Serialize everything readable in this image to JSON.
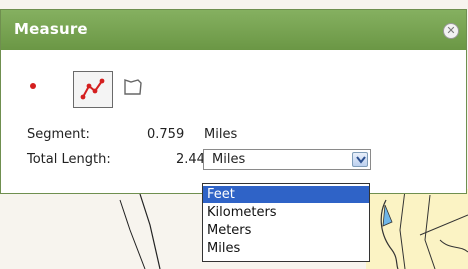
{
  "panel": {
    "title": "Measure",
    "close_icon": "close-circle-icon"
  },
  "tools": [
    {
      "name": "point-tool",
      "icon": "red-dot-icon",
      "color": "#d41f1f"
    },
    {
      "name": "line-tool",
      "icon": "polyline-icon",
      "color": "#d41f1f",
      "active": true
    },
    {
      "name": "area-tool",
      "icon": "polygon-outline-icon"
    }
  ],
  "segment": {
    "label": "Segment:",
    "value": "0.759",
    "unit": "Miles"
  },
  "total": {
    "label": "Total Length:",
    "value": "2.44"
  },
  "units_select": {
    "selected": "Miles",
    "options": [
      "Feet",
      "Kilometers",
      "Meters",
      "Miles"
    ],
    "highlighted_option": "Feet"
  },
  "colors": {
    "titlebar_green": "#76a251",
    "highlight_blue": "#2f63c7",
    "map_yellow": "#fbf3c4"
  }
}
